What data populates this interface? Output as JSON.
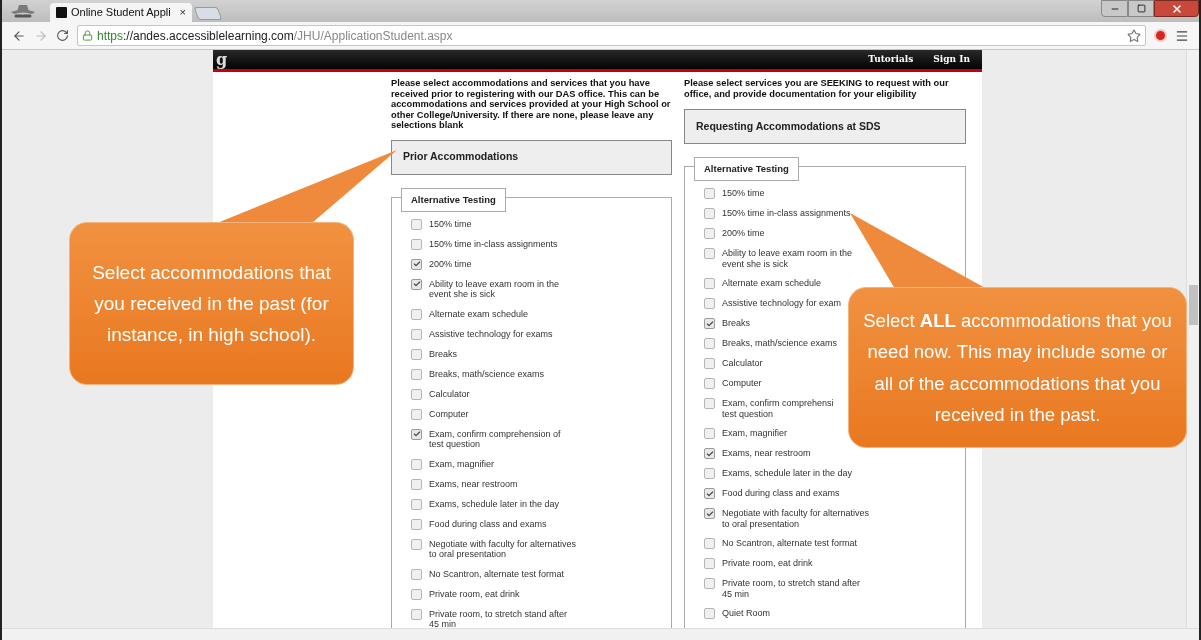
{
  "browser": {
    "tab_title": "Online Student Appli",
    "tab_close": "×",
    "url_scheme": "https",
    "url_host": "://andes.accessiblelearning.com",
    "url_path": "/JHU/ApplicationStudent.aspx"
  },
  "header": {
    "logo": "g",
    "links": [
      "Tutorials",
      "Sign In"
    ]
  },
  "columns": [
    {
      "intro": "Please select accommodations and services that you have received prior to registering with our DAS office. This can be accommodations and services provided at your High School or other College/University. If there are none, please leave any selections blank",
      "heading": "Prior Accommodations",
      "group": "Alternative Testing",
      "items": [
        {
          "label": "150% time",
          "checked": false
        },
        {
          "label": "150% time in-class assignments",
          "checked": false
        },
        {
          "label": "200% time",
          "checked": true
        },
        {
          "label": "Ability to leave exam room in the event she is sick",
          "checked": true
        },
        {
          "label": "Alternate exam schedule",
          "checked": false
        },
        {
          "label": "Assistive technology for exams",
          "checked": false
        },
        {
          "label": "Breaks",
          "checked": false
        },
        {
          "label": "Breaks, math/science exams",
          "checked": false
        },
        {
          "label": "Calculator",
          "checked": false
        },
        {
          "label": "Computer",
          "checked": false
        },
        {
          "label": "Exam, confirm comprehension of test question",
          "checked": true
        },
        {
          "label": "Exam, magnifier",
          "checked": false
        },
        {
          "label": "Exams, near restroom",
          "checked": false
        },
        {
          "label": "Exams, schedule later in the day",
          "checked": false
        },
        {
          "label": "Food during class and exams",
          "checked": false
        },
        {
          "label": "Negotiate with faculty for alternatives to oral presentation",
          "checked": false
        },
        {
          "label": "No Scantron, alternate test format",
          "checked": false
        },
        {
          "label": "Private room, eat drink",
          "checked": false
        },
        {
          "label": "Private room, to stretch stand after 45 min",
          "checked": false
        }
      ]
    },
    {
      "intro": "Please select services you are SEEKING to request with our office, and provide documentation for your eligibility",
      "heading": "Requesting Accommodations at SDS",
      "group": "Alternative Testing",
      "items": [
        {
          "label": "150% time",
          "checked": false
        },
        {
          "label": "150% time in-class assignments",
          "checked": false
        },
        {
          "label": "200% time",
          "checked": false
        },
        {
          "label": "Ability to leave exam room in the event she is sick",
          "checked": false
        },
        {
          "label": "Alternate exam schedule",
          "checked": false
        },
        {
          "label": "Assistive technology for exam",
          "checked": false
        },
        {
          "label": "Breaks",
          "checked": true
        },
        {
          "label": "Breaks, math/science exams",
          "checked": false
        },
        {
          "label": "Calculator",
          "checked": false
        },
        {
          "label": "Computer",
          "checked": false
        },
        {
          "label": "Exam, confirm comprehensi\ntest question",
          "checked": false
        },
        {
          "label": "Exam, magnifier",
          "checked": false
        },
        {
          "label": "Exams, near restroom",
          "checked": true
        },
        {
          "label": "Exams, schedule later in the day",
          "checked": false
        },
        {
          "label": "Food during class and exams",
          "checked": true
        },
        {
          "label": "Negotiate with faculty for alternatives to oral presentation",
          "checked": true
        },
        {
          "label": "No Scantron, alternate test format",
          "checked": false
        },
        {
          "label": "Private room, eat drink",
          "checked": false
        },
        {
          "label": "Private room, to stretch stand after 45 min",
          "checked": false
        },
        {
          "label": "Quiet Room",
          "checked": false
        }
      ]
    }
  ],
  "callouts": [
    {
      "text": "Select accommodations that you received in the past (for instance, in high school)."
    },
    {
      "text": "Select **ALL** accommodations that you need now. This may include some or all of the accommodations that you received in the past."
    }
  ]
}
